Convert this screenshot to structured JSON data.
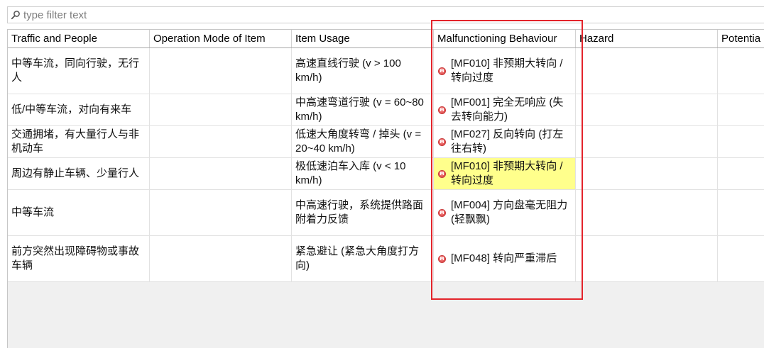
{
  "filter": {
    "placeholder": "type filter text",
    "icon": "search-icon"
  },
  "table": {
    "headers": {
      "traffic": "Traffic and People",
      "operation_mode": "Operation Mode of Item",
      "item_usage": "Item Usage",
      "malfunction": "Malfunctioning Behaviour",
      "hazard": "Hazard",
      "potential": "Potentia"
    },
    "malfunction_icon": {
      "name": "malfunction-icon",
      "letter": "M"
    },
    "rows": [
      {
        "traffic": "中等车流，同向行驶，无行人",
        "operation_mode": "",
        "item_usage": "高速直线行驶 (v > 100 km/h)",
        "malfunction": "[MF010] 非预期大转向 / 转向过度",
        "hazard": "",
        "potential": ""
      },
      {
        "traffic": "低/中等车流，对向有来车",
        "operation_mode": "",
        "item_usage": "中高速弯道行驶 (v = 60~80 km/h)",
        "malfunction": "[MF001] 完全无响应 (失去转向能力)",
        "hazard": "",
        "potential": ""
      },
      {
        "traffic": "交通拥堵，有大量行人与非机动车",
        "operation_mode": "",
        "item_usage": "低速大角度转弯 / 掉头 (v = 20~40 km/h)",
        "malfunction": "[MF027] 反向转向 (打左往右转)",
        "hazard": "",
        "potential": ""
      },
      {
        "traffic": "周边有静止车辆、少量行人",
        "operation_mode": "",
        "item_usage": "极低速泊车入库 (v < 10 km/h)",
        "malfunction": "[MF010] 非预期大转向 / 转向过度",
        "hazard": "",
        "potential": ""
      },
      {
        "traffic": "中等车流",
        "operation_mode": "",
        "item_usage": "中高速行驶，系统提供路面附着力反馈",
        "malfunction": "[MF004] 方向盘毫无阻力 (轻飘飘)",
        "hazard": "",
        "potential": ""
      },
      {
        "traffic": "前方突然出现障碍物或事故车辆",
        "operation_mode": "",
        "item_usage": "紧急避让 (紧急大角度打方向)",
        "malfunction": "[MF048] 转向严重滞后",
        "hazard": "",
        "potential": ""
      }
    ]
  },
  "colors": {
    "cell_highlight": "#ffff8c",
    "annotation_box": "#e3242b",
    "malfunction_icon": "#e05252",
    "empty_area": "#f0f0f0"
  }
}
